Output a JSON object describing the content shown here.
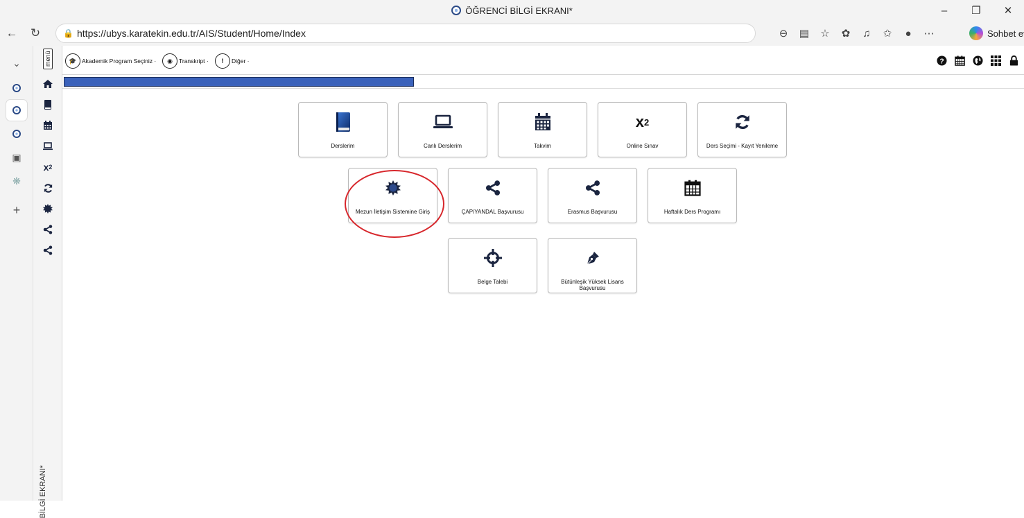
{
  "window": {
    "title": "ÖĞRENCİ BİLGİ EKRANI*",
    "controls": [
      "minimize",
      "restore",
      "close"
    ]
  },
  "addressbar": {
    "url": "https://ubys.karatekin.edu.tr/AIS/Student/Home/Index",
    "copilot_label": "Sohbet et"
  },
  "app": {
    "menu_label": "menü",
    "vertical_title": "BİLGİ EKRANI*",
    "toolbar": {
      "academic_program": "Akademik Program Seçiniz ·",
      "transcript": "Transkript ·",
      "other": "Diğer ·"
    }
  },
  "tiles": {
    "derslerim": "Derslerim",
    "canli": "Canlı Derslerim",
    "takvim": "Takvim",
    "online_sinav": "Online Sınav",
    "ders_secimi": "Ders Seçimi - Kayıt Yenileme",
    "mezun": "Mezun İletişim Sistemine Giriş",
    "cap": "ÇAP/YANDAL Başvurusu",
    "erasmus": "Erasmus Başvurusu",
    "haftalik": "Haftalık Ders Programı",
    "belge": "Belge Talebi",
    "butunlesik": "Bütünleşik Yüksek Lisans Başvurusu"
  },
  "colors": {
    "accent": "#1b2540",
    "progress": "#3b62bb",
    "highlight_circle": "#d7262b"
  }
}
